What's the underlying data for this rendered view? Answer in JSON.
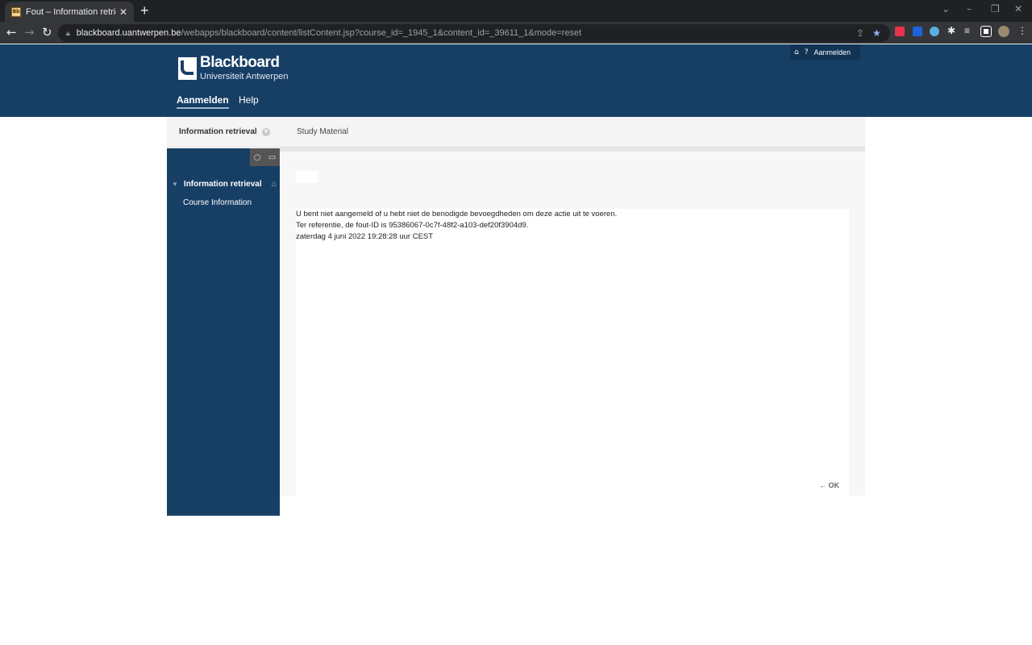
{
  "browser": {
    "tab_title": "Fout – Information retrieval",
    "tab_favicon": "Bb",
    "url_host": "blackboard.uantwerpen.be",
    "url_path": "/webapps/blackboard/content/listContent.jsp?course_id=_1945_1&content_id=_39611_1&mode=reset",
    "extensions": [
      "red-extension-icon",
      "blue-extension-icon",
      "cloud-extension-icon",
      "puzzle-icon",
      "reading-list-icon",
      "side-panel-icon",
      "profile-avatar"
    ]
  },
  "header": {
    "logo_title": "Blackboard",
    "logo_subtitle": "Universiteit Antwerpen",
    "nav": [
      {
        "label": "Aanmelden",
        "active": true
      },
      {
        "label": "Help",
        "active": false
      }
    ],
    "utility_login": "Aanmelden"
  },
  "breadcrumb": {
    "course": "Information retrieval",
    "page": "Study Material"
  },
  "course_menu": {
    "title": "Information retrieval",
    "items": [
      "Course Information"
    ]
  },
  "message": {
    "lines": [
      "U bent niet aangemeld of u hebt niet de benodigde bevoegdheden om deze actie uit te voeren.",
      "Ter referentie, de fout-ID is 95386067-0c7f-48f2-a103-def20f3904d9.",
      "zaterdag 4 juni 2022 19:28:28 uur CEST"
    ],
    "ok_label": "← OK"
  },
  "colors": {
    "brand": "#173f66",
    "content_bg": "#f7f7f7"
  }
}
